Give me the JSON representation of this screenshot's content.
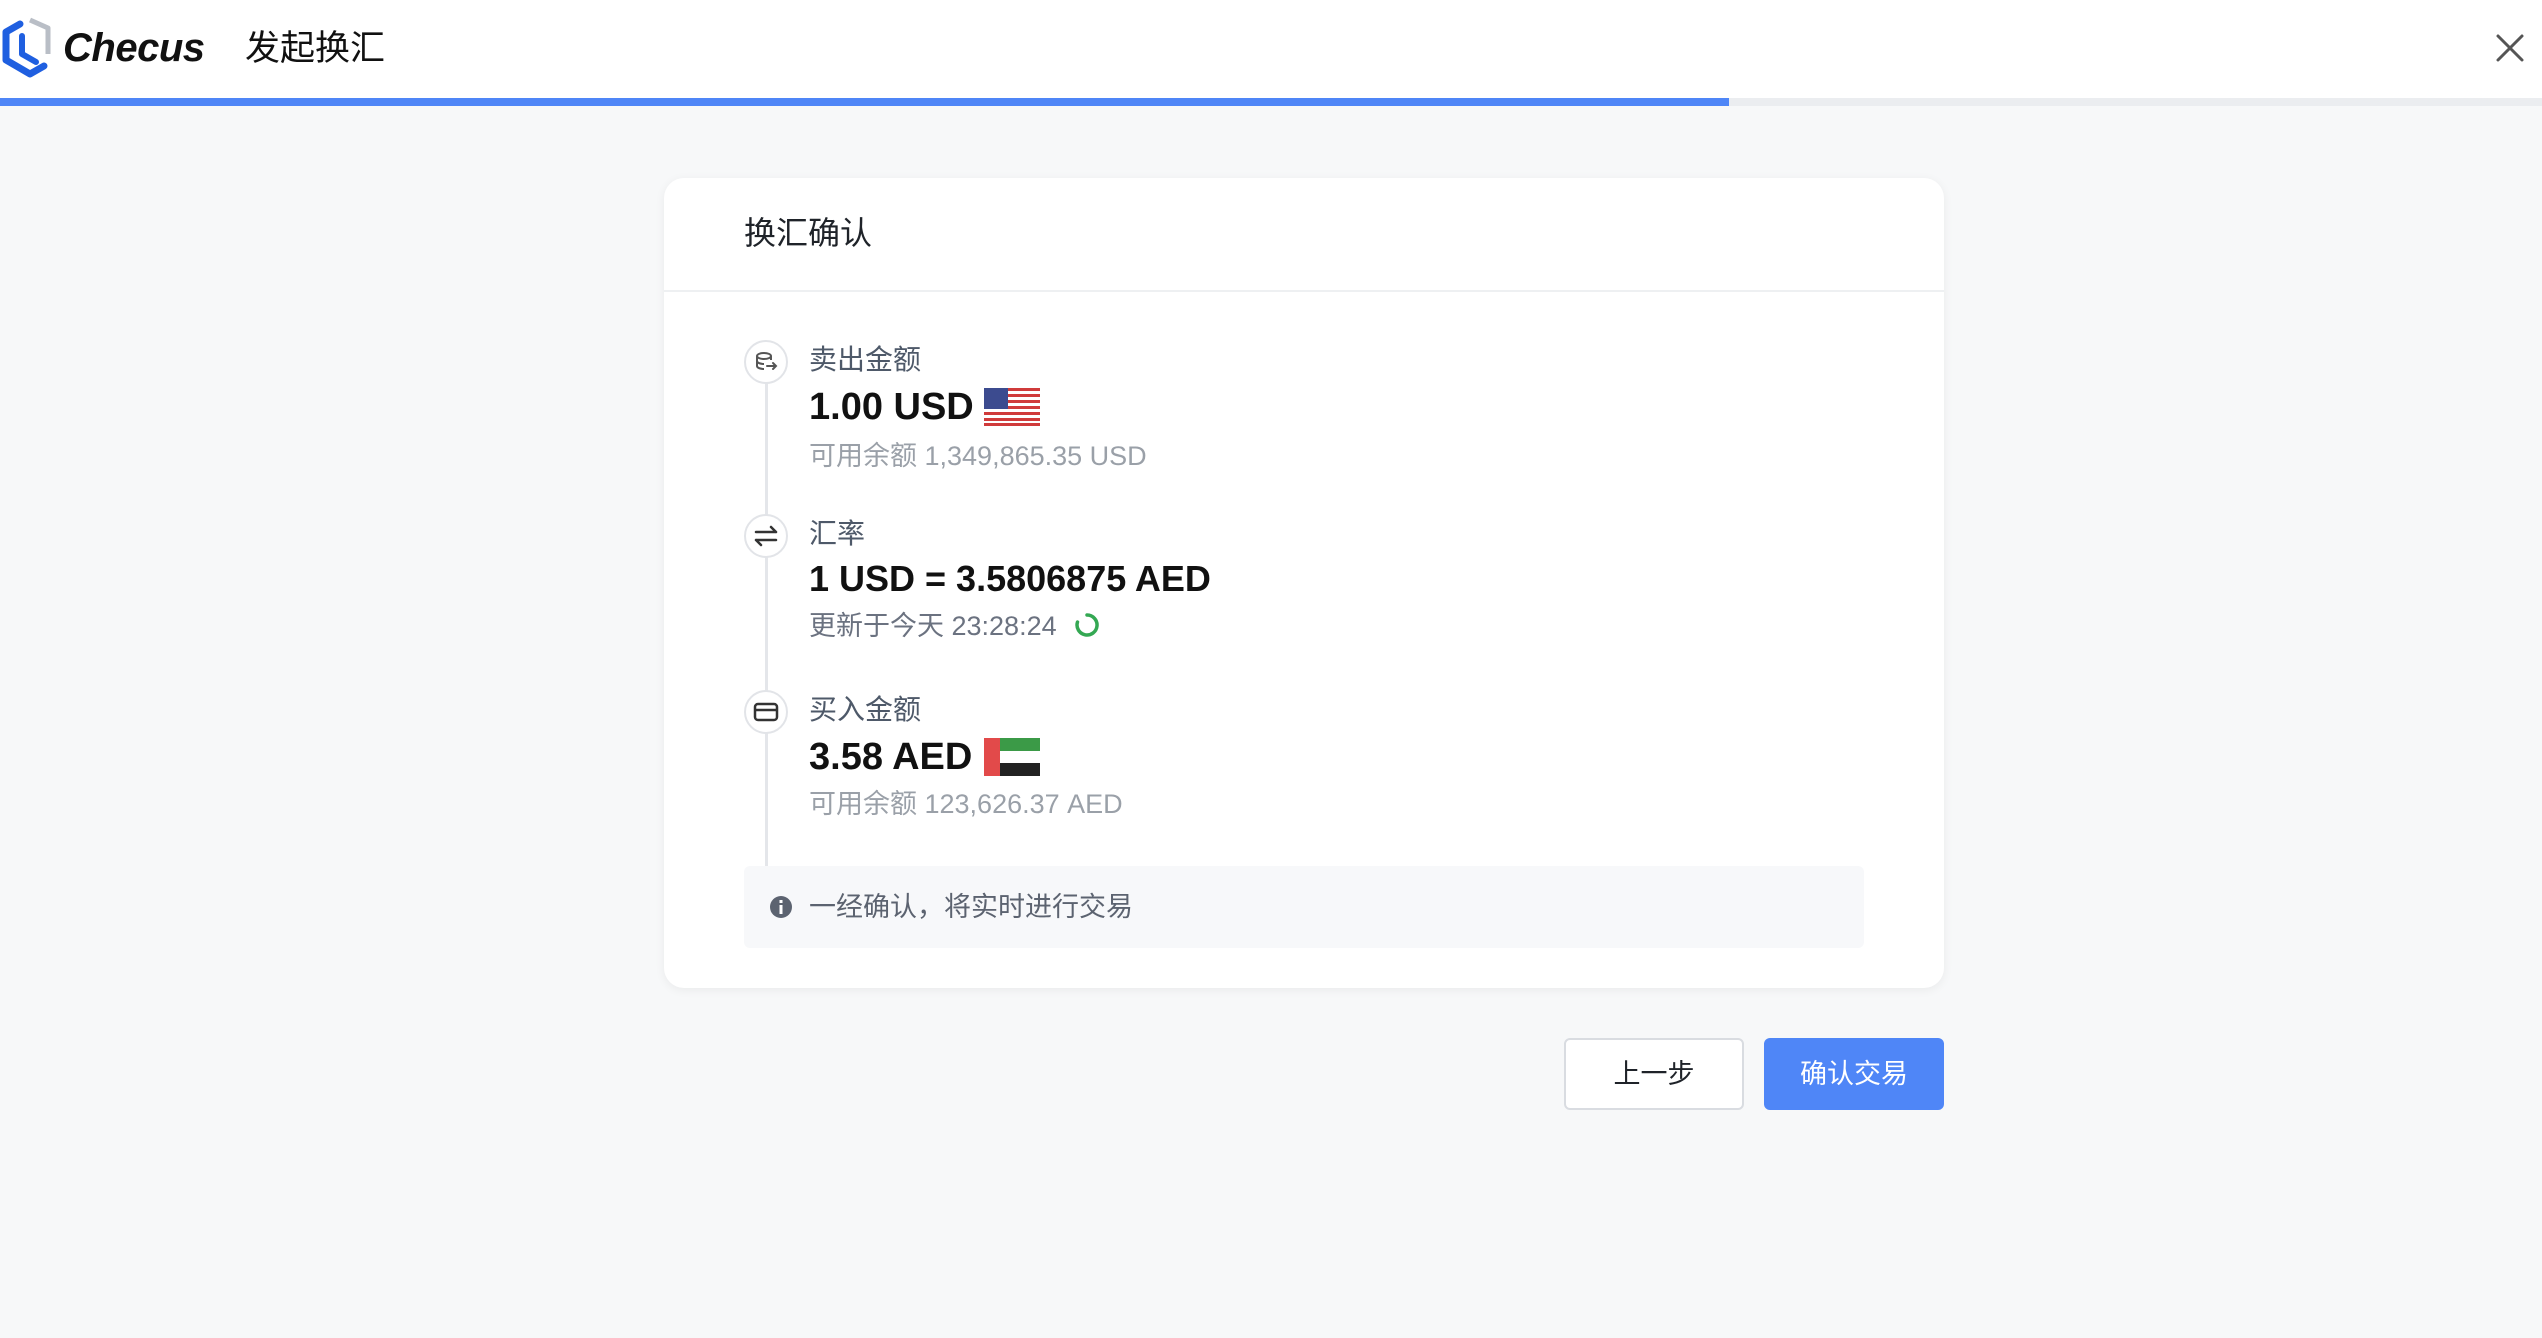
{
  "header": {
    "brand": "Checus",
    "title": "发起换汇",
    "progress_percent": 68
  },
  "card": {
    "title": "换汇确认",
    "sell": {
      "label": "卖出金额",
      "amount": "1.00 USD",
      "balance": "可用余额 1,349,865.35 USD",
      "flag": "us-flag"
    },
    "rate": {
      "label": "汇率",
      "value": "1 USD = 3.5806875 AED",
      "updated": "更新于今天 23:28:24"
    },
    "buy": {
      "label": "买入金额",
      "amount": "3.58 AED",
      "balance": "可用余额 123,626.37 AED",
      "flag": "ae-flag"
    },
    "notice": "一经确认，将实时进行交易"
  },
  "actions": {
    "prev_label": "上一步",
    "confirm_label": "确认交易"
  },
  "colors": {
    "accent": "#4f86f7",
    "refresh": "#34a853"
  }
}
